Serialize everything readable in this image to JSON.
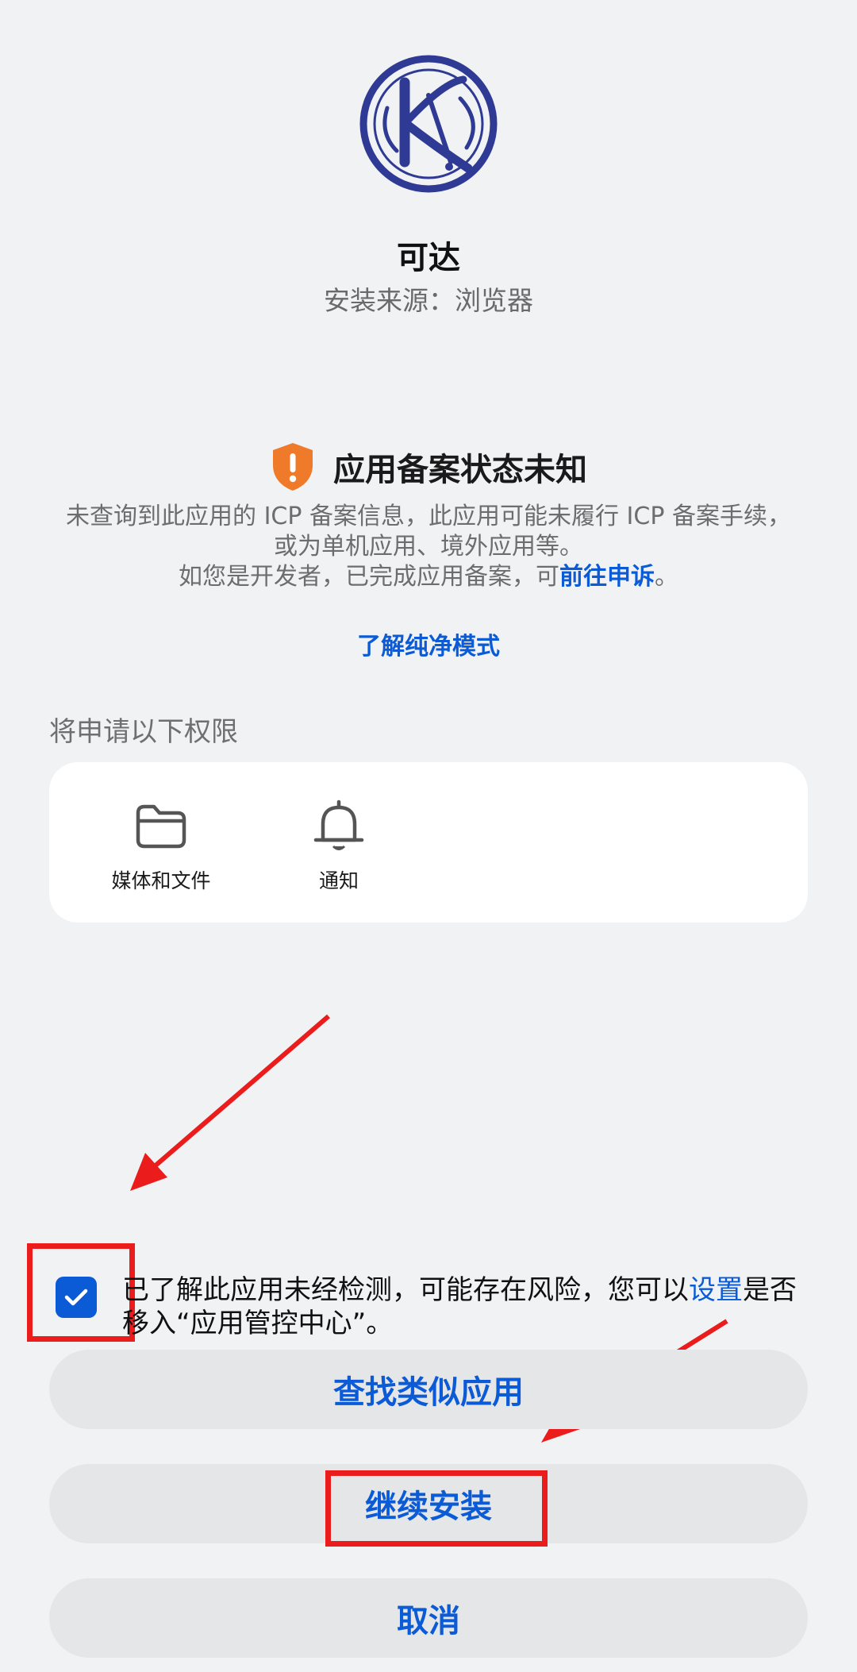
{
  "app": {
    "name": "可达",
    "source": "安装来源：浏览器"
  },
  "warning": {
    "title": "应用备案状态未知",
    "line1": "未查询到此应用的 ICP 备案信息，此应用可能未履行 ICP 备案手续，",
    "line2": "或为单机应用、境外应用等。",
    "line3_prefix": "如您是开发者，已完成应用备案，可",
    "appeal_link": "前往申诉",
    "line3_suffix": "。"
  },
  "pure_mode_link": "了解纯净模式",
  "permissions": {
    "heading": "将申请以下权限",
    "items": [
      {
        "label": "媒体和文件",
        "icon": "folder-icon"
      },
      {
        "label": "通知",
        "icon": "bell-icon"
      }
    ]
  },
  "consent": {
    "checked": true,
    "text_prefix": "已了解此应用未经检测，可能存在风险，您可以",
    "settings_link": "设置",
    "text_suffix": "是否移入“应用管控中心”。"
  },
  "buttons": {
    "find_similar": "查找类似应用",
    "continue_install": "继续安装",
    "cancel": "取消"
  },
  "colors": {
    "accent": "#0b5bd6",
    "warning": "#ef7a2a",
    "annotation": "#ea1c1c",
    "background": "#f1f2f4"
  }
}
